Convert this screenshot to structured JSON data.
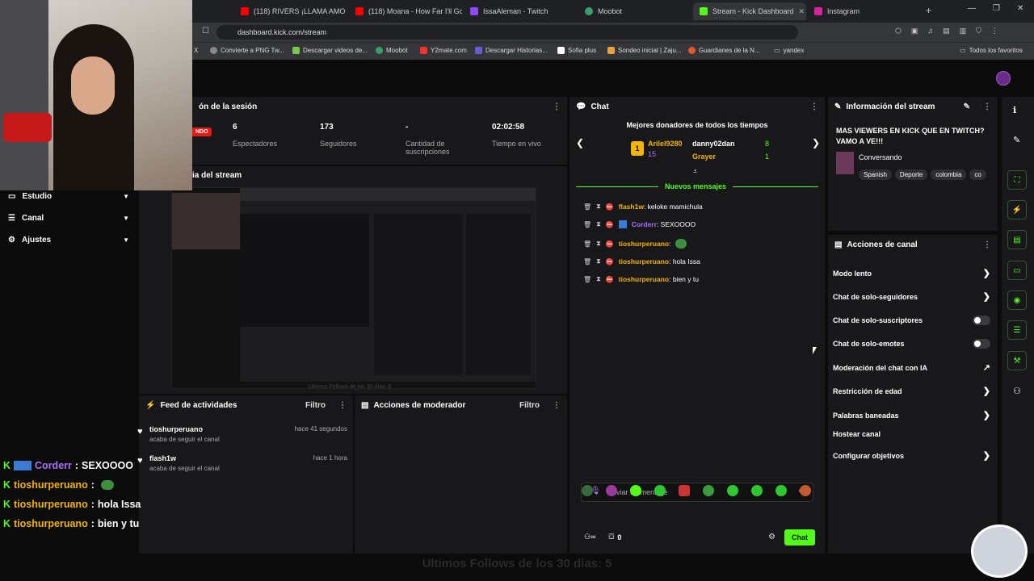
{
  "browser": {
    "tabs": [
      "(118) RIVERS ¡LLAMA AMO",
      "(118) Moana - How Far I'll Go",
      "IssaAleman - Twitch",
      "Moobot",
      "Stream - Kick Dashboard",
      "Instagram"
    ],
    "url": "dashboard.kick.com/stream",
    "bookmarks": [
      "X",
      "Convierte a PNG Tw...",
      "Descargar videos de...",
      "Moobot",
      "Y2mate.com",
      "Descargar Historias...",
      "Sofia plus",
      "Sondeo inicial | Zaju...",
      "Guardianes de la N...",
      "yandex",
      "Todos los favoritos"
    ]
  },
  "session": {
    "title": "ón de la sesión",
    "live_badge": "NDO",
    "stats": [
      {
        "value": "6",
        "label": "Espectadores"
      },
      {
        "value": "173",
        "label": "Seguidores"
      },
      {
        "value": "-",
        "label": "Cantidad de suscripciones"
      },
      {
        "value": "02:02:58",
        "label": "Tiempo en vivo"
      }
    ]
  },
  "preview": {
    "title": "ia del stream",
    "overlay_caption": "Ultimos Follows de los 30 días: 5"
  },
  "sidebar": {
    "items": [
      "Estudio",
      "Canal",
      "Ajustes"
    ]
  },
  "chat": {
    "title": "Chat",
    "donors_title": "Mejores donadores de todos los tiempos",
    "donors": [
      {
        "name": "Arilel9280",
        "amount": "15"
      },
      {
        "name": "danny02dan",
        "amount": "8"
      },
      {
        "name": "Grayer",
        "amount": "1"
      }
    ],
    "rank_badge": "1",
    "new_messages": "Nuevos mensajes",
    "messages": [
      {
        "user": "flash1w",
        "text": "keloke mamichula",
        "color": "#f5b400"
      },
      {
        "user": "Corderr",
        "text": "SEXOOOO",
        "color": "#a970ff"
      },
      {
        "user": "tioshurperuano",
        "text": "",
        "color": "#f5b400"
      },
      {
        "user": "tioshurperuano",
        "text": "hola Issa",
        "color": "#f5b400"
      },
      {
        "user": "tioshurperuano",
        "text": "bien y tu",
        "color": "#f5b400"
      }
    ],
    "input_placeholder": "Enviar un mensaje",
    "points": "0",
    "send_label": "Chat"
  },
  "stream_info": {
    "title": "Información del stream",
    "stream_title": "MAS VIEWERS EN KICK QUE EN TWITCH? VAMO A VE!!!",
    "category": "Conversando",
    "tags": [
      "Spanish",
      "Deporte",
      "colombia",
      "co"
    ]
  },
  "channel_actions": {
    "title": "Acciones de canal",
    "items": [
      {
        "label": "Modo lento",
        "kind": "chevron"
      },
      {
        "label": "Chat de solo-seguidores",
        "kind": "chevron"
      },
      {
        "label": "Chat de solo-suscriptores",
        "kind": "toggle"
      },
      {
        "label": "Chat de solo-emotes",
        "kind": "toggle"
      },
      {
        "label": "Moderación del chat con IA",
        "kind": "external"
      },
      {
        "label": "Restricción de edad",
        "kind": "chevron"
      },
      {
        "label": "Palabras baneadas",
        "kind": "chevron"
      },
      {
        "label": "Hostear canal",
        "kind": "none"
      },
      {
        "label": "Configurar objetivos",
        "kind": "chevron"
      }
    ]
  },
  "activity_feed": {
    "title": "Feed de actividades",
    "filter": "Filtro",
    "items": [
      {
        "user": "tioshurperuano",
        "sub": "acaba de seguir el canal",
        "time": "hace 41 segundos"
      },
      {
        "user": "flash1w",
        "sub": "acaba de seguir el canal",
        "time": "hace 1 hora"
      }
    ]
  },
  "mod_actions": {
    "title": "Acciones de moderador",
    "filter": "Filtro"
  },
  "overlay_chat": [
    {
      "user": "Corderr",
      "text": "SEXOOOO",
      "color": "#a970ff"
    },
    {
      "user": "tioshurperuano",
      "text": "",
      "color": "#f5b400"
    },
    {
      "user": "tioshurperuano",
      "text": "hola Issa",
      "color": "#f5b400"
    },
    {
      "user": "tioshurperuano",
      "text": "bien y tu",
      "color": "#f5b400"
    }
  ],
  "colors": {
    "accent": "#53fc18",
    "panel": "#18181b",
    "background": "#0b0b0c"
  }
}
